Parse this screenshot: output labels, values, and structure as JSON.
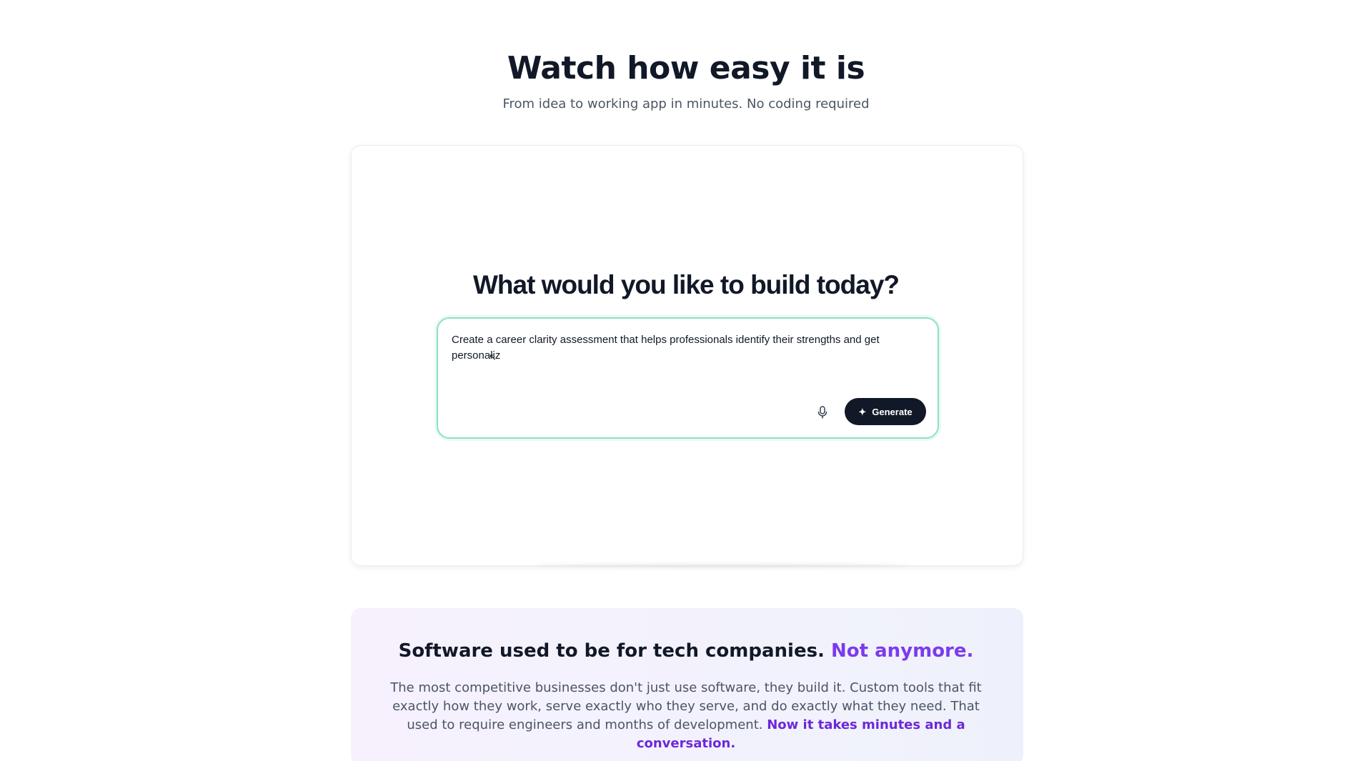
{
  "hero": {
    "title": "Watch how easy it is",
    "subtitle": "From idea to working app in minutes. No coding required"
  },
  "demo": {
    "heading": "What would you like to build today?",
    "prompt_value": "Create a career clarity assessment that helps professionals identify their strengths and get personaliz",
    "mic_icon": "microphone-icon",
    "generate_label": "Generate",
    "generate_icon": "sparkle-icon"
  },
  "mission": {
    "title_main": "Software used to be for tech companies.",
    "title_accent": "Not anymore.",
    "body_main": "The most competitive businesses don't just use software, they build it. Custom tools that fit exactly how they work, serve exactly who they serve, and do exactly what they need. That used to require engineers and months of development.",
    "body_accent": "Now it takes minutes and a conversation."
  },
  "colors": {
    "text_primary": "#111827",
    "text_secondary": "#4b5563",
    "accent_purple": "#7c3aed",
    "accent_purple_dark": "#6d28d9",
    "prompt_border": "#8ee0c4",
    "button_bg": "#111827"
  }
}
